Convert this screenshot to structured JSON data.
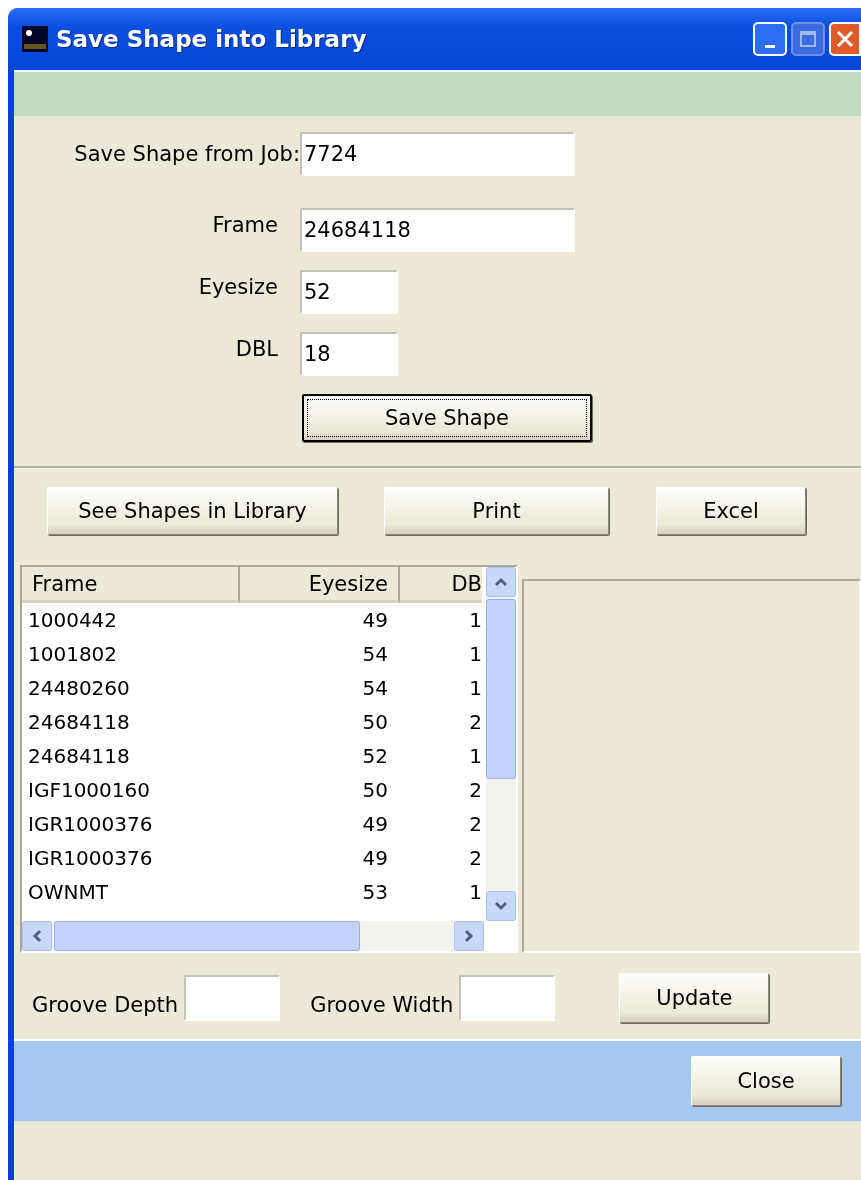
{
  "window": {
    "title": "Save Shape into Library"
  },
  "form": {
    "fields": [
      {
        "label": "Save Shape from Job:",
        "value": "7724"
      },
      {
        "label": "Frame",
        "value": "24684118"
      },
      {
        "label": "Eyesize",
        "value": "52"
      },
      {
        "label": "DBL",
        "value": "18"
      }
    ],
    "save_button": {
      "label": "Save Shape",
      "focused": true
    }
  },
  "actions": [
    "See Shapes in Library",
    "Print",
    "Excel"
  ],
  "list": {
    "columns": [
      "Frame",
      "Eyesize",
      "DB"
    ],
    "rows": [
      [
        "1000442",
        "49",
        "1"
      ],
      [
        "1001802",
        "54",
        "1"
      ],
      [
        "24480260",
        "54",
        "1"
      ],
      [
        "24684118",
        "50",
        "2"
      ],
      [
        "24684118",
        "52",
        "1"
      ],
      [
        "IGF1000160",
        "50",
        "2"
      ],
      [
        "IGR1000376",
        "49",
        "2"
      ],
      [
        "IGR1000376",
        "49",
        "2"
      ],
      [
        "OWNMT",
        "53",
        "1"
      ]
    ]
  },
  "groove": {
    "fields": [
      {
        "label": "Groove Depth"
      },
      {
        "label": "Groove Width"
      }
    ],
    "button": "Update"
  },
  "footer": {
    "button": "Close"
  }
}
